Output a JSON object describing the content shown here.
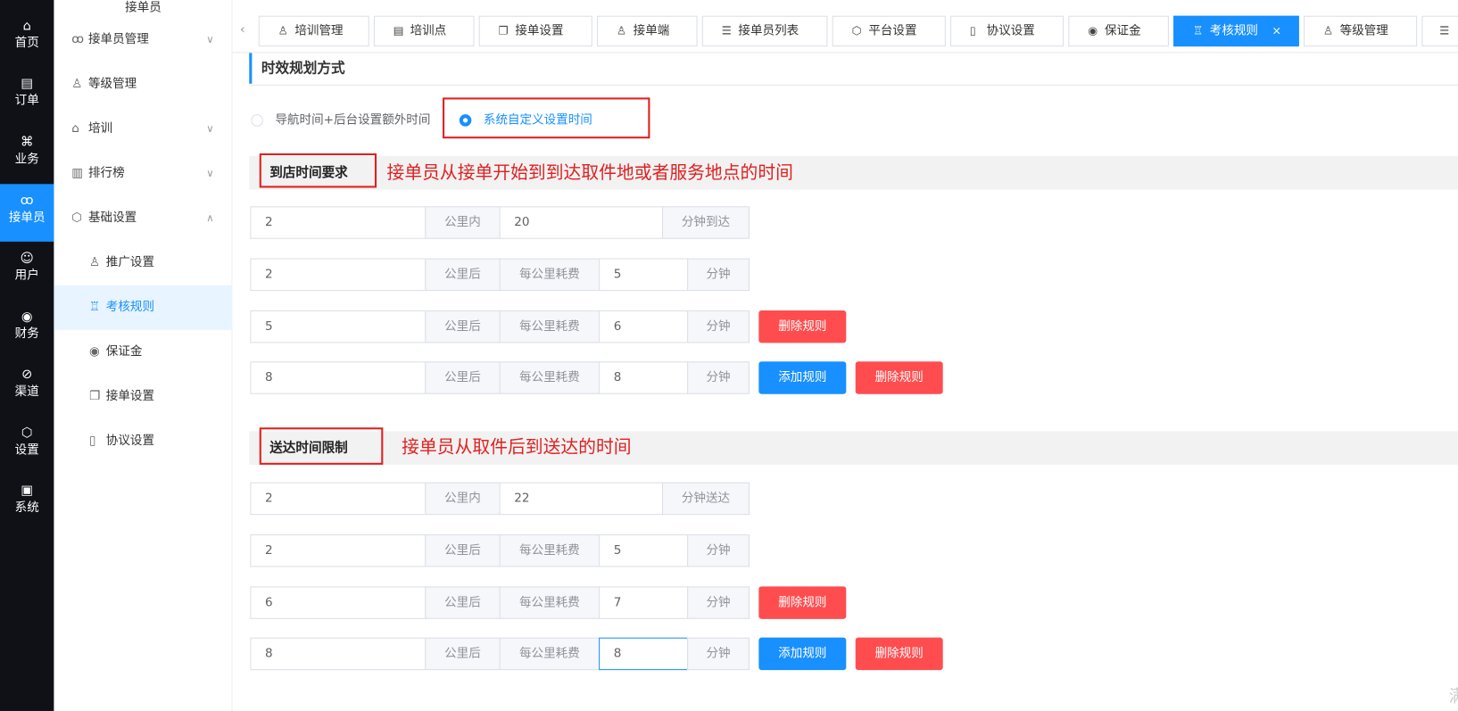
{
  "rail": [
    {
      "icon": "home-icon",
      "glyph": "⌂",
      "label": "首页"
    },
    {
      "icon": "order-icon",
      "glyph": "▤",
      "label": "订单"
    },
    {
      "icon": "business-icon",
      "glyph": "⌘",
      "label": "业务"
    },
    {
      "icon": "bike-icon",
      "glyph": "ꝏ",
      "label": "接单员"
    },
    {
      "icon": "user-icon",
      "glyph": "☺",
      "label": "用户"
    },
    {
      "icon": "finance-icon",
      "glyph": "◉",
      "label": "财务"
    },
    {
      "icon": "channel-icon",
      "glyph": "⊘",
      "label": "渠道"
    },
    {
      "icon": "settings-icon",
      "glyph": "⬡",
      "label": "设置"
    },
    {
      "icon": "system-icon",
      "glyph": "▣",
      "label": "系统"
    }
  ],
  "sidebar": {
    "title": "接单员",
    "items": [
      {
        "icon": "bike-icon",
        "glyph": "ꝏ",
        "label": "接单员管理",
        "chevron": "∨"
      },
      {
        "icon": "level-icon",
        "glyph": "♙",
        "label": "等级管理",
        "chevron": ""
      },
      {
        "icon": "training-icon",
        "glyph": "⌂",
        "label": "培训",
        "chevron": "∨"
      },
      {
        "icon": "ranking-icon",
        "glyph": "▥",
        "label": "排行榜",
        "chevron": "∨"
      },
      {
        "icon": "settings-icon",
        "glyph": "⬡",
        "label": "基础设置",
        "chevron": "∧"
      }
    ],
    "subitems": [
      {
        "icon": "promotion-icon",
        "glyph": "♙",
        "label": "推广设置"
      },
      {
        "icon": "assessment-icon",
        "glyph": "♖",
        "label": "考核规则"
      },
      {
        "icon": "deposit-icon",
        "glyph": "◉",
        "label": "保证金"
      },
      {
        "icon": "order-settings-icon",
        "glyph": "❐",
        "label": "接单设置"
      },
      {
        "icon": "agreement-icon",
        "glyph": "▯",
        "label": "协议设置"
      }
    ]
  },
  "tabs": {
    "arrow": "‹",
    "items": [
      {
        "icon": "user-icon",
        "glyph": "♙",
        "label": "培训管理"
      },
      {
        "icon": "list-doc-icon",
        "glyph": "▤",
        "label": "培训点"
      },
      {
        "icon": "copy-icon",
        "glyph": "❐",
        "label": "接单设置"
      },
      {
        "icon": "user-voice-icon",
        "glyph": "♙",
        "label": "接单端"
      },
      {
        "icon": "list-icon",
        "glyph": "☰",
        "label": "接单员列表"
      },
      {
        "icon": "hexagon-icon",
        "glyph": "⬡",
        "label": "平台设置"
      },
      {
        "icon": "book-icon",
        "glyph": "▯",
        "label": "协议设置"
      },
      {
        "icon": "coin-icon",
        "glyph": "◉",
        "label": "保证金"
      },
      {
        "icon": "assessment-icon",
        "glyph": "♖",
        "label": "考核规则",
        "close": "×"
      },
      {
        "icon": "level-icon",
        "glyph": "♙",
        "label": "等级管理"
      },
      {
        "icon": "list-icon",
        "glyph": "☰",
        "label": ""
      }
    ]
  },
  "main": {
    "section_title": "时效规划方式",
    "radio": {
      "option1": "导航时间+后台设置额外时间",
      "option2": "系统自定义设置时间",
      "selected": "option2"
    },
    "arrival": {
      "title": "到店时间要求",
      "annotation": "接单员从接单开始到到达取件地或者服务地点的时间",
      "base": {
        "km": "2",
        "km_label": "公里内",
        "minutes": "20",
        "minutes_label": "分钟到达"
      },
      "rules": [
        {
          "km": "2",
          "after": "公里后",
          "per": "每公里耗费",
          "min": "5",
          "unit": "分钟",
          "add": false,
          "del": false
        },
        {
          "km": "5",
          "after": "公里后",
          "per": "每公里耗费",
          "min": "6",
          "unit": "分钟",
          "add": false,
          "del": true
        },
        {
          "km": "8",
          "after": "公里后",
          "per": "每公里耗费",
          "min": "8",
          "unit": "分钟",
          "add": true,
          "del": true
        }
      ]
    },
    "delivery": {
      "title": "送达时间限制",
      "annotation": "接单员从取件后到送达的时间",
      "base": {
        "km": "2",
        "km_label": "公里内",
        "minutes": "22",
        "minutes_label": "分钟送达"
      },
      "rules": [
        {
          "km": "2",
          "after": "公里后",
          "per": "每公里耗费",
          "min": "5",
          "unit": "分钟",
          "add": false,
          "del": false
        },
        {
          "km": "6",
          "after": "公里后",
          "per": "每公里耗费",
          "min": "7",
          "unit": "分钟",
          "add": false,
          "del": true
        },
        {
          "km": "8",
          "after": "公里后",
          "per": "每公里耗费",
          "min": "8",
          "unit": "分钟",
          "add": true,
          "del": true
        }
      ]
    },
    "buttons": {
      "add": "添加规则",
      "delete": "删除规则"
    },
    "edge_text": "满"
  }
}
